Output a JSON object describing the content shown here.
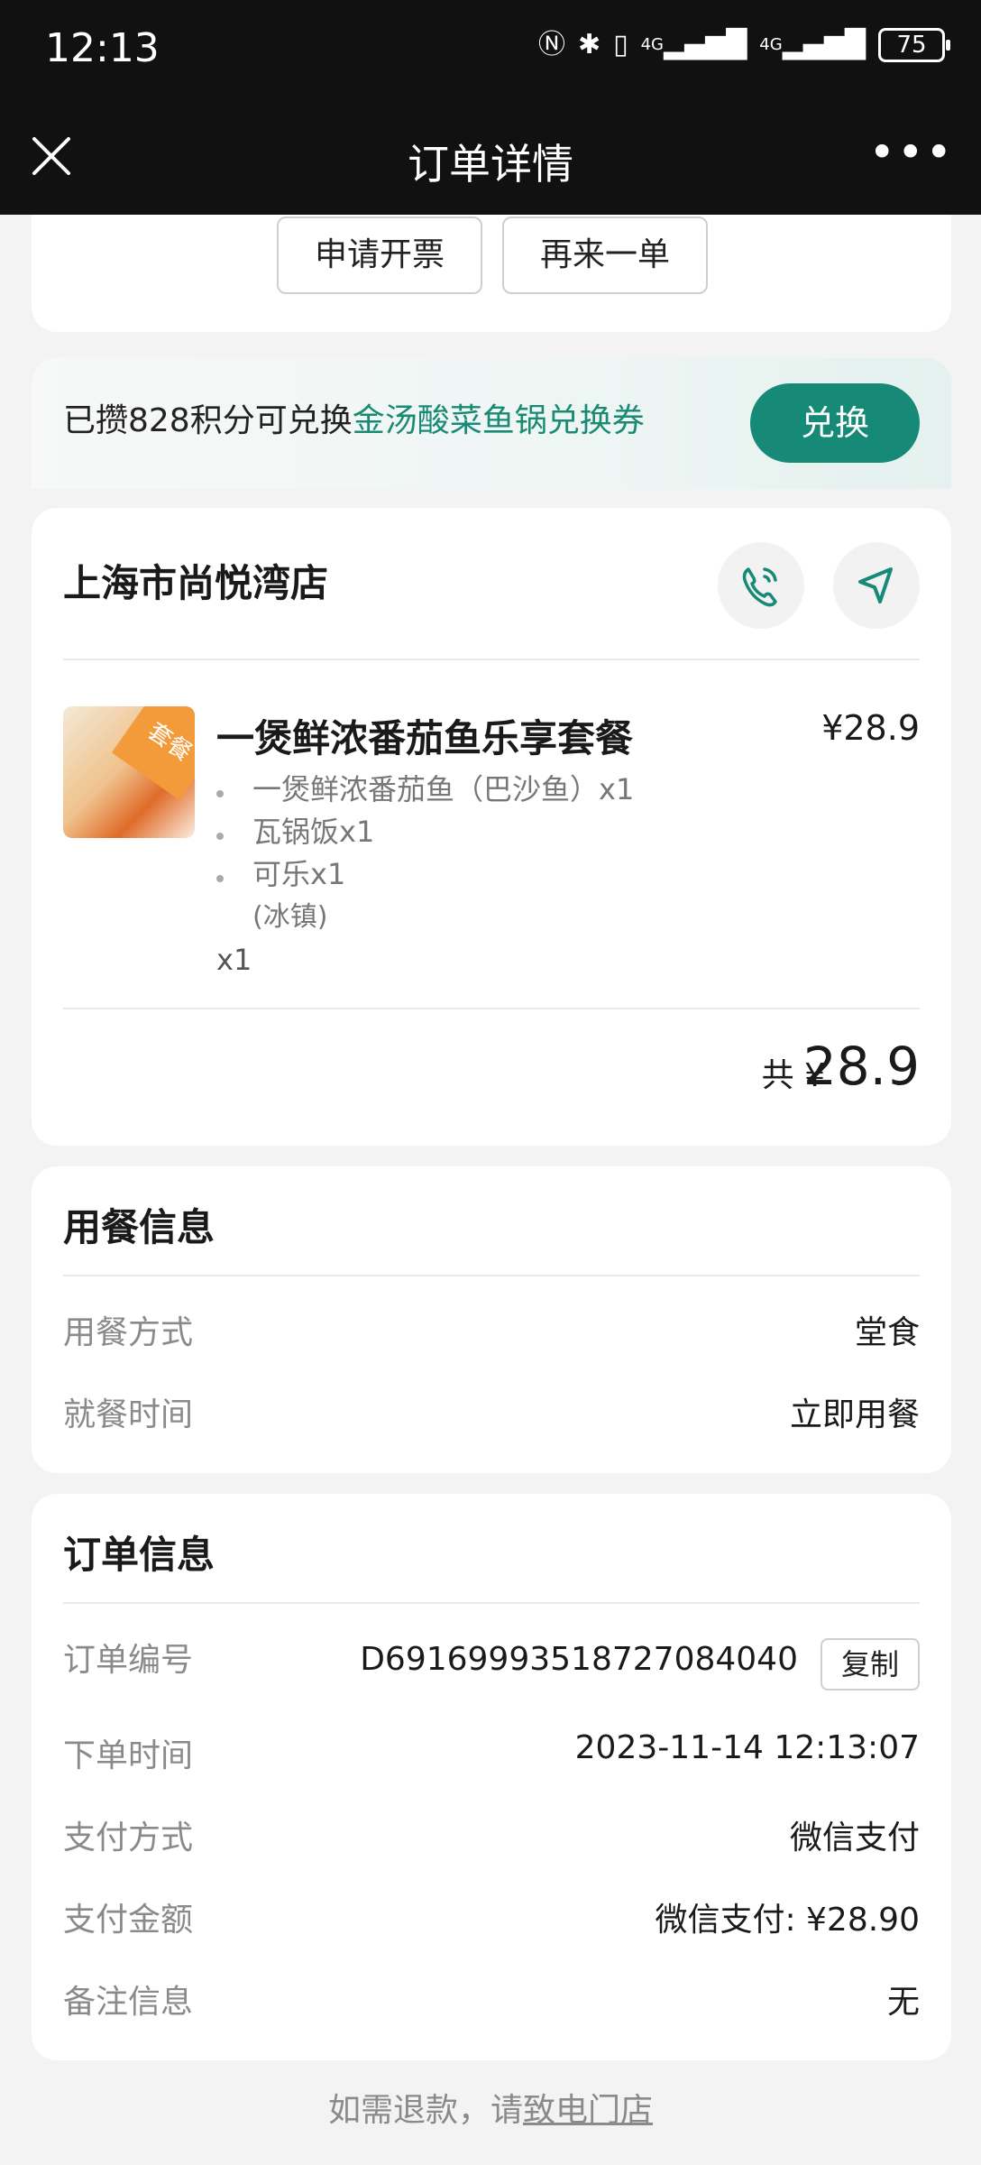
{
  "status_bar": {
    "time": "12:13",
    "battery": "75",
    "network1": "4G",
    "network2": "4G"
  },
  "header": {
    "title": "订单详情",
    "close_icon": "close-icon",
    "more_icon": "more-icon"
  },
  "actions": {
    "invoice": "申请开票",
    "reorder": "再来一单"
  },
  "promo": {
    "prefix": "已攒828积分可兑换",
    "highlight": "金汤酸菜鱼锅兑换券",
    "button": "兑换"
  },
  "store": {
    "name": "上海市尚悦湾店"
  },
  "product": {
    "badge": "套餐",
    "name": "一煲鲜浓番茄鱼乐享套餐",
    "price": "¥28.9",
    "items": [
      "一煲鲜浓番茄鱼（巴沙鱼）x1",
      "瓦锅饭x1",
      "可乐x1"
    ],
    "item_note": "(冰镇)",
    "quantity": "x1"
  },
  "total": {
    "label": "共 ¥",
    "value": "28.9"
  },
  "dining": {
    "title": "用餐信息",
    "rows": [
      {
        "label": "用餐方式",
        "value": "堂食"
      },
      {
        "label": "就餐时间",
        "value": "立即用餐"
      }
    ]
  },
  "order": {
    "title": "订单信息",
    "number_label": "订单编号",
    "number": "D6916999351872708404​0",
    "copy": "复制",
    "rows": [
      {
        "label": "下单时间",
        "value": "2023-11-14 12:13:07"
      },
      {
        "label": "支付方式",
        "value": "微信支付"
      },
      {
        "label": "支付金额",
        "value": "微信支付: ¥28.90"
      },
      {
        "label": "备注信息",
        "value": "无"
      }
    ]
  },
  "footer": {
    "prefix": "如需退款，请",
    "link": "致电门店"
  },
  "colors": {
    "accent": "#168a76",
    "highlight_text": "#1a8a75",
    "header_bg": "#111111"
  }
}
